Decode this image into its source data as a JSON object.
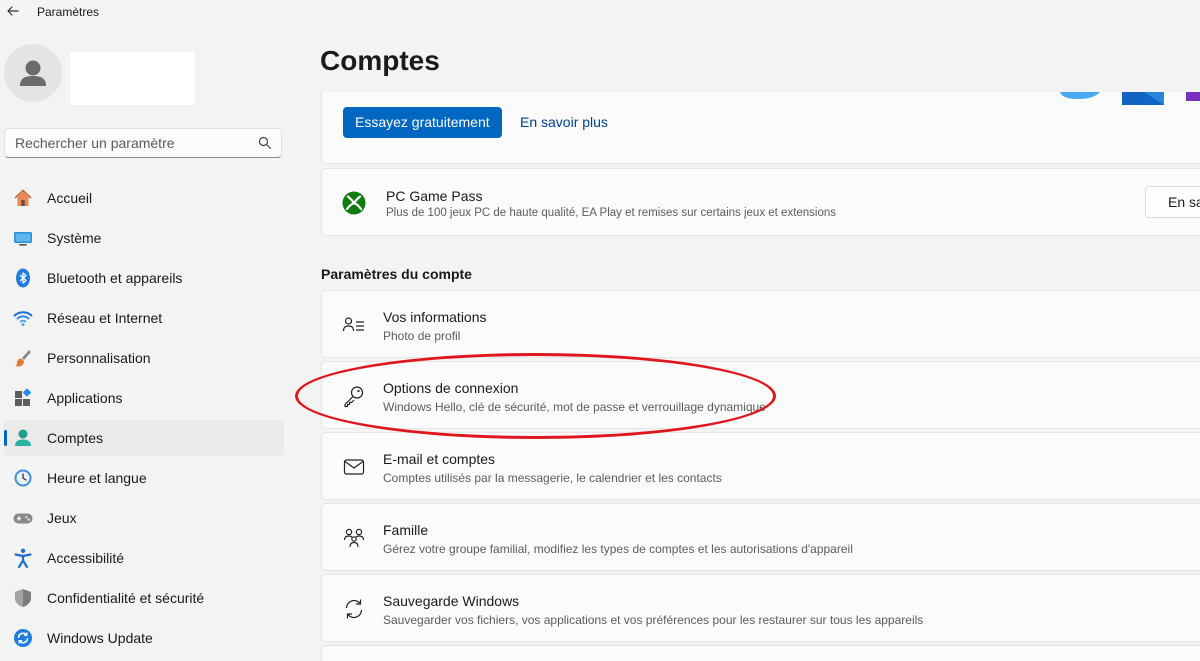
{
  "window": {
    "title": "Paramètres",
    "back_icon": "back-arrow-icon"
  },
  "profile": {
    "avatar_icon": "person-icon"
  },
  "search": {
    "placeholder": "Rechercher un paramètre",
    "value": "",
    "icon": "search-icon"
  },
  "sidebar": {
    "items": [
      {
        "label": "Accueil",
        "icon": "home-icon",
        "active": false
      },
      {
        "label": "Système",
        "icon": "system-icon",
        "active": false
      },
      {
        "label": "Bluetooth et appareils",
        "icon": "bluetooth-icon",
        "active": false
      },
      {
        "label": "Réseau et Internet",
        "icon": "wifi-icon",
        "active": false
      },
      {
        "label": "Personnalisation",
        "icon": "brush-icon",
        "active": false
      },
      {
        "label": "Applications",
        "icon": "apps-icon",
        "active": false
      },
      {
        "label": "Comptes",
        "icon": "accounts-icon",
        "active": true
      },
      {
        "label": "Heure et langue",
        "icon": "clock-icon",
        "active": false
      },
      {
        "label": "Jeux",
        "icon": "gamepad-icon",
        "active": false
      },
      {
        "label": "Accessibilité",
        "icon": "accessibility-icon",
        "active": false
      },
      {
        "label": "Confidentialité et sécurité",
        "icon": "shield-icon",
        "active": false
      },
      {
        "label": "Windows Update",
        "icon": "update-icon",
        "active": false
      }
    ]
  },
  "main": {
    "title": "Comptes",
    "promo": {
      "try_label": "Essayez gratuitement",
      "learn_label": "En savoir plus"
    },
    "gamepass": {
      "title": "PC Game Pass",
      "subtitle": "Plus de 100 jeux PC de haute qualité, EA Play et remises sur certains jeux et extensions",
      "button_label": "En sa"
    },
    "section_title": "Paramètres du compte",
    "rows": [
      {
        "title": "Vos informations",
        "subtitle": "Photo de profil",
        "icon": "user-info-icon"
      },
      {
        "title": "Options de connexion",
        "subtitle": "Windows Hello, clé de sécurité, mot de passe et verrouillage dynamique",
        "icon": "key-icon"
      },
      {
        "title": "E-mail et comptes",
        "subtitle": "Comptes utilisés par la messagerie, le calendrier et les contacts",
        "icon": "mail-icon"
      },
      {
        "title": "Famille",
        "subtitle": "Gérez votre groupe familial, modifiez les types de comptes et les autorisations d'appareil",
        "icon": "family-icon"
      },
      {
        "title": "Sauvegarde Windows",
        "subtitle": "Sauvegarder vos fichiers, vos applications et vos préférences pour les restaurer sur tous les appareils",
        "icon": "backup-icon"
      }
    ]
  },
  "colors": {
    "accent": "#0067c0",
    "annotation": "#e0161e",
    "xbox_green": "#107c10"
  }
}
